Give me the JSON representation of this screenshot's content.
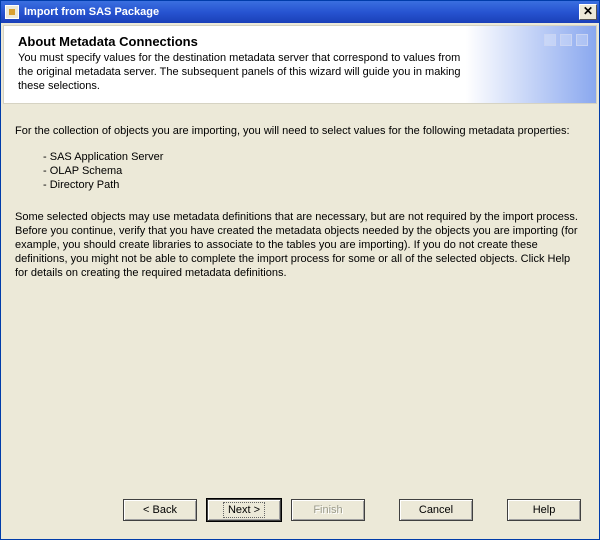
{
  "window": {
    "title": "Import from SAS Package"
  },
  "header": {
    "title": "About Metadata Connections",
    "subtitle": "You must specify values for the destination metadata server that correspond to values from the original metadata server. The subsequent panels of this wizard will guide you in making these selections."
  },
  "content": {
    "intro": "For the collection of objects you are importing, you will need to select values for the following metadata properties:",
    "bullets": [
      "SAS Application Server",
      "OLAP Schema",
      "Directory Path"
    ],
    "paragraph": "Some selected objects may use metadata definitions that are necessary, but are not required by the import process. Before you continue, verify that you have created the metadata objects needed by the objects you are importing (for example, you should create libraries to associate to the tables you are importing). If you do not create these definitions, you might not be able to complete the import process for some or all of the selected objects. Click Help for details on creating the required metadata definitions."
  },
  "buttons": {
    "back": "< Back",
    "next": "Next >",
    "finish": "Finish",
    "cancel": "Cancel",
    "help": "Help"
  }
}
